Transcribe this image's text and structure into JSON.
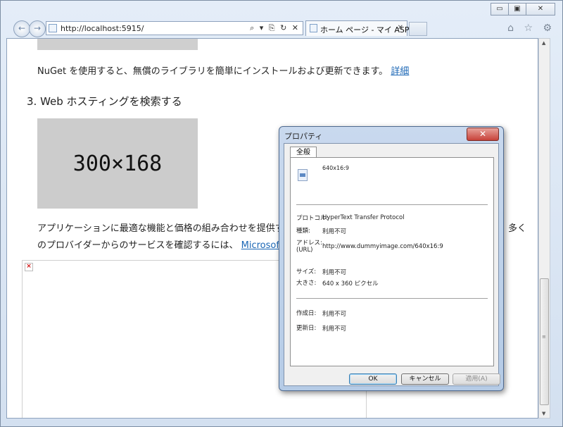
{
  "window": {
    "minimize_glyph": "▭",
    "maximize_glyph": "▣",
    "close_glyph": "✕"
  },
  "nav": {
    "back_glyph": "←",
    "forward_glyph": "→",
    "address_url": "http://localhost:5915/",
    "address_tools": "⌕ ▾ ⎘ ↻ ✕",
    "tab_title": "ホーム ページ - マイ ASP....",
    "tab_close": "✕",
    "toolbar_icons": "⌂ ☆ ⚙"
  },
  "content": {
    "nuget_text": "NuGet を使用すると、無償のライブラリを簡単にインストールおよび更新できます。",
    "nuget_link": "詳細",
    "heading3": "3. Web ホスティングを検索する",
    "image_placeholder": "300×168",
    "hosting_text_line1": "アプリケーションに最適な機能と価格の組み合わせを提供する W",
    "hosting_text_line1_end": "多く",
    "hosting_text_line2": "のプロバイダーからのサービスを確認するには、",
    "hosting_link": "Microsoft.com",
    "broken_image_glyph": "×"
  },
  "scrollbar": {
    "up_glyph": "▲",
    "down_glyph": "▼",
    "grip_glyph": "≡"
  },
  "dialog": {
    "title": "プロパティ",
    "close_glyph": "✕",
    "tab_general": "全般",
    "file_name": "640x16:9",
    "protocol_label": "プロトコル:",
    "protocol_value": "HyperText Transfer Protocol",
    "type_label": "種類:",
    "type_value": "利用不可",
    "address_label": "アドレス:\n(URL)",
    "address_value": "http://www.dummyimage.com/640x16:9",
    "size_label": "サイズ:",
    "size_value": "利用不可",
    "dimensions_label": "大きさ:",
    "dimensions_value": "640 x 360 ピクセル",
    "created_label": "作成日:",
    "created_value": "利用不可",
    "modified_label": "更新日:",
    "modified_value": "利用不可",
    "ok_label": "OK",
    "cancel_label": "キャンセル",
    "apply_label": "適用(A)"
  }
}
